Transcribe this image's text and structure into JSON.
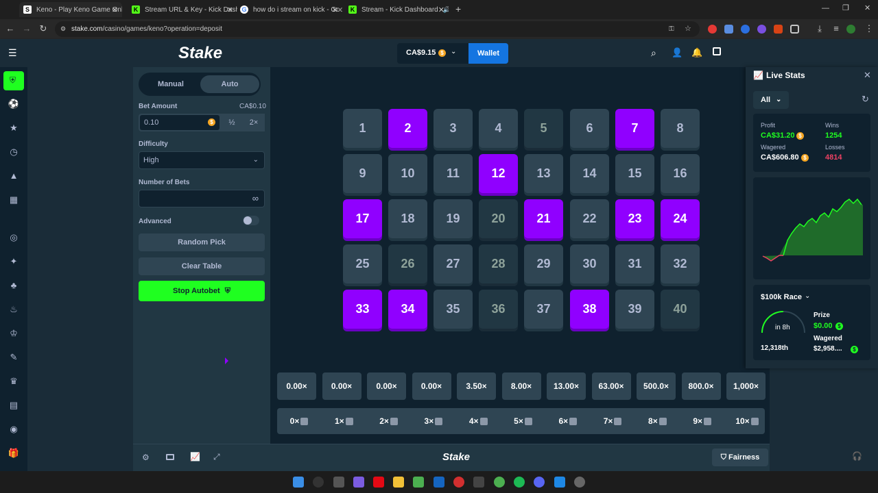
{
  "browser": {
    "tabs": [
      {
        "title": "Keno - Play Keno Game Online",
        "color": "#ffffff"
      },
      {
        "title": "Stream URL & Key - Kick Dashb",
        "color": "#53fc18"
      },
      {
        "title": "how do i stream on kick - Goog",
        "color": "#4285f4"
      },
      {
        "title": "Stream - Kick Dashboard",
        "color": "#53fc18"
      }
    ],
    "new_tab": "+",
    "url_host": "stake.com",
    "url_path": "/casino/games/keno?operation=deposit"
  },
  "header": {
    "logo": "Stake",
    "balance": "CA$9.15",
    "wallet_label": "Wallet"
  },
  "controls": {
    "mode_manual": "Manual",
    "mode_auto": "Auto",
    "bet_amount_label": "Bet Amount",
    "bet_amount_converted": "CA$0.10",
    "bet_amount_value": "0.10",
    "half_label": "½",
    "double_label": "2×",
    "difficulty_label": "Difficulty",
    "difficulty_value": "High",
    "number_of_bets_label": "Number of Bets",
    "infinity_symbol": "∞",
    "advanced_label": "Advanced",
    "random_pick_label": "Random Pick",
    "clear_table_label": "Clear Table",
    "stop_autobet_label": "Stop Autobet"
  },
  "board": {
    "tiles": [
      {
        "n": "1",
        "state": "none"
      },
      {
        "n": "2",
        "state": "pick"
      },
      {
        "n": "3",
        "state": "none"
      },
      {
        "n": "4",
        "state": "none"
      },
      {
        "n": "5",
        "state": "hit"
      },
      {
        "n": "6",
        "state": "none"
      },
      {
        "n": "7",
        "state": "pick"
      },
      {
        "n": "8",
        "state": "none"
      },
      {
        "n": "9",
        "state": "none"
      },
      {
        "n": "10",
        "state": "none"
      },
      {
        "n": "11",
        "state": "none"
      },
      {
        "n": "12",
        "state": "pick"
      },
      {
        "n": "13",
        "state": "none"
      },
      {
        "n": "14",
        "state": "none"
      },
      {
        "n": "15",
        "state": "none"
      },
      {
        "n": "16",
        "state": "none"
      },
      {
        "n": "17",
        "state": "pick"
      },
      {
        "n": "18",
        "state": "none"
      },
      {
        "n": "19",
        "state": "none"
      },
      {
        "n": "20",
        "state": "hit"
      },
      {
        "n": "21",
        "state": "pick"
      },
      {
        "n": "22",
        "state": "none"
      },
      {
        "n": "23",
        "state": "pick"
      },
      {
        "n": "24",
        "state": "pick"
      },
      {
        "n": "25",
        "state": "none"
      },
      {
        "n": "26",
        "state": "hit"
      },
      {
        "n": "27",
        "state": "none"
      },
      {
        "n": "28",
        "state": "hit"
      },
      {
        "n": "29",
        "state": "none"
      },
      {
        "n": "30",
        "state": "none"
      },
      {
        "n": "31",
        "state": "none"
      },
      {
        "n": "32",
        "state": "none"
      },
      {
        "n": "33",
        "state": "pick"
      },
      {
        "n": "34",
        "state": "pick"
      },
      {
        "n": "35",
        "state": "none"
      },
      {
        "n": "36",
        "state": "hit"
      },
      {
        "n": "37",
        "state": "none"
      },
      {
        "n": "38",
        "state": "pick"
      },
      {
        "n": "39",
        "state": "none"
      },
      {
        "n": "40",
        "state": "hit"
      }
    ],
    "multipliers": [
      "0.00×",
      "0.00×",
      "0.00×",
      "0.00×",
      "3.50×",
      "8.00×",
      "13.00×",
      "63.00×",
      "500.0×",
      "800.0×",
      "1,000×"
    ],
    "hit_counts": [
      "0×",
      "1×",
      "2×",
      "3×",
      "4×",
      "5×",
      "6×",
      "7×",
      "8×",
      "9×",
      "10×"
    ]
  },
  "footer": {
    "logo": "Stake",
    "fairness_label": "Fairness"
  },
  "live_stats": {
    "title": "Live Stats",
    "filter": "All",
    "profit_label": "Profit",
    "profit_value": "CA$31.20",
    "wins_label": "Wins",
    "wins_value": "1254",
    "wagered_label": "Wagered",
    "wagered_value": "CA$606.80",
    "losses_label": "Losses",
    "losses_value": "4814",
    "race_title": "$100k Race",
    "race_timer": "in 8h",
    "race_position": "12,318th",
    "prize_label": "Prize",
    "prize_value": "$0.00",
    "race_wagered_label": "Wagered",
    "race_wagered_value": "$2,958....",
    "colors": {
      "profit": "#1fff20",
      "losses": "#ed4163",
      "accent": "#1475e1",
      "pick": "#9000ff"
    }
  }
}
